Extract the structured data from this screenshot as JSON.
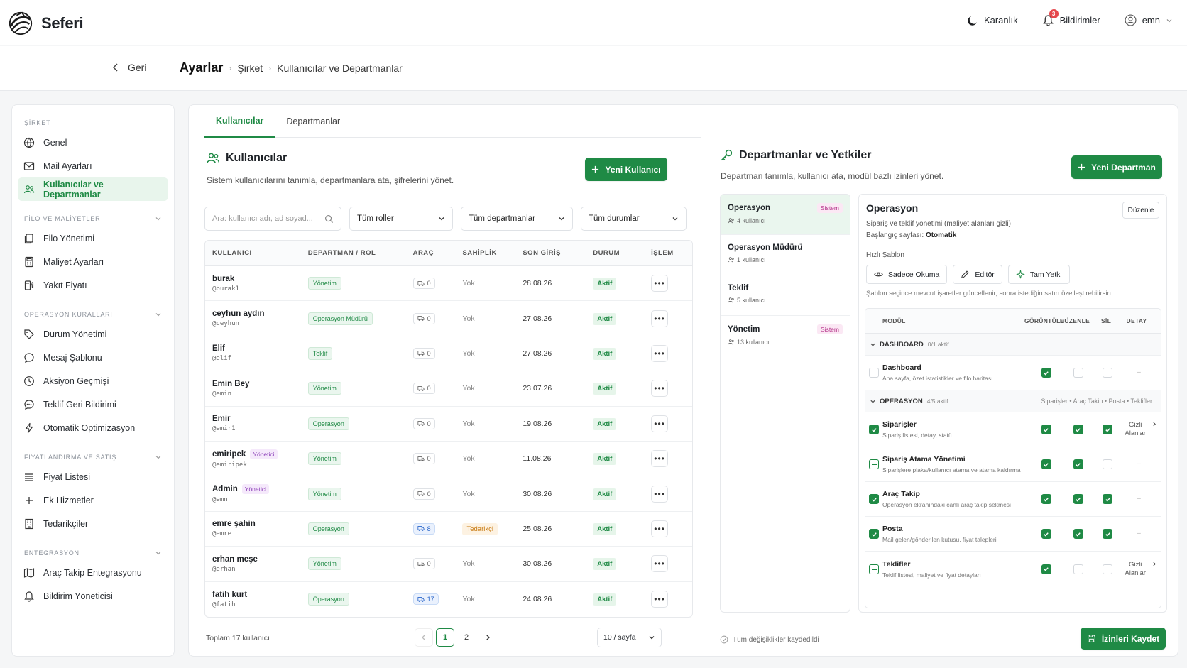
{
  "app": {
    "name": "Seferi"
  },
  "top": {
    "theme": "Karanlık",
    "notifications": "Bildirimler",
    "notif_count": "3",
    "user": "emn"
  },
  "crumbs": {
    "back": "Geri",
    "title": "Ayarlar",
    "level1": "Şirket",
    "level2": "Kullanıcılar ve Departmanlar"
  },
  "sidebar": {
    "sections": [
      {
        "title": "ŞİRKET",
        "items": [
          "Genel",
          "Mail Ayarları",
          "Kullanıcılar ve Departmanlar"
        ]
      },
      {
        "title": "FİLO VE MALİYETLER",
        "items": [
          "Filo Yönetimi",
          "Maliyet Ayarları",
          "Yakıt Fiyatı"
        ]
      },
      {
        "title": "OPERASYON KURALLARI",
        "items": [
          "Durum Yönetimi",
          "Mesaj Şablonu",
          "Aksiyon Geçmişi",
          "Teklif Geri Bildirimi",
          "Otomatik Optimizasyon"
        ]
      },
      {
        "title": "FİYATLANDIRMA VE SATIŞ",
        "items": [
          "Fiyat Listesi",
          "Ek Hizmetler",
          "Tedarikçiler"
        ]
      },
      {
        "title": "ENTEGRASYON",
        "items": [
          "Araç Takip Entegrasyonu",
          "Bildirim Yöneticisi"
        ]
      }
    ]
  },
  "tabs": [
    "Kullanıcılar",
    "Departmanlar"
  ],
  "users": {
    "title": "Kullanıcılar",
    "subtitle": "Sistem kullanıcılarını tanımla, departmanlara ata, şifrelerini yönet.",
    "new_button": "Yeni Kullanıcı",
    "search_placeholder": "Ara: kullanıcı adı, ad soyad...",
    "filter_roles": "Tüm roller",
    "filter_depts": "Tüm departmanlar",
    "filter_status": "Tüm durumlar",
    "columns": [
      "KULLANICI",
      "DEPARTMAN / ROL",
      "ARAÇ",
      "SAHİPLİK",
      "SON GİRİŞ",
      "DURUM",
      "İŞLEM"
    ],
    "rows": [
      {
        "name": "burak",
        "handle": "@burak1",
        "admin": "",
        "role": "Yönetim",
        "vehicles": "0",
        "vehicles_on": false,
        "own": "Yok",
        "own_tag": false,
        "last": "28.08.26",
        "status": "Aktif"
      },
      {
        "name": "ceyhun aydın",
        "handle": "@ceyhun",
        "admin": "",
        "role": "Operasyon Müdürü",
        "vehicles": "0",
        "vehicles_on": false,
        "own": "Yok",
        "own_tag": false,
        "last": "27.08.26",
        "status": "Aktif"
      },
      {
        "name": "Elif",
        "handle": "@elif",
        "admin": "",
        "role": "Teklif",
        "vehicles": "0",
        "vehicles_on": false,
        "own": "Yok",
        "own_tag": false,
        "last": "27.08.26",
        "status": "Aktif"
      },
      {
        "name": "Emin Bey",
        "handle": "@emin",
        "admin": "",
        "role": "Yönetim",
        "vehicles": "0",
        "vehicles_on": false,
        "own": "Yok",
        "own_tag": false,
        "last": "23.07.26",
        "status": "Aktif"
      },
      {
        "name": "Emir",
        "handle": "@emir1",
        "admin": "",
        "role": "Operasyon",
        "vehicles": "0",
        "vehicles_on": false,
        "own": "Yok",
        "own_tag": false,
        "last": "19.08.26",
        "status": "Aktif"
      },
      {
        "name": "emiripek",
        "handle": "@emiripek",
        "admin": "Yönetici",
        "role": "Yönetim",
        "vehicles": "0",
        "vehicles_on": false,
        "own": "Yok",
        "own_tag": false,
        "last": "11.08.26",
        "status": "Aktif"
      },
      {
        "name": "Admin",
        "handle": "@emn",
        "admin": "Yönetici",
        "role": "Yönetim",
        "vehicles": "0",
        "vehicles_on": false,
        "own": "Yok",
        "own_tag": false,
        "last": "30.08.26",
        "status": "Aktif"
      },
      {
        "name": "emre şahin",
        "handle": "@emre",
        "admin": "",
        "role": "Operasyon",
        "vehicles": "8",
        "vehicles_on": true,
        "own": "Tedarikçi",
        "own_tag": true,
        "last": "25.08.26",
        "status": "Aktif"
      },
      {
        "name": "erhan meşe",
        "handle": "@erhan",
        "admin": "",
        "role": "Yönetim",
        "vehicles": "0",
        "vehicles_on": false,
        "own": "Yok",
        "own_tag": false,
        "last": "30.08.26",
        "status": "Aktif"
      },
      {
        "name": "fatih kurt",
        "handle": "@fatih",
        "admin": "",
        "role": "Operasyon",
        "vehicles": "17",
        "vehicles_on": true,
        "own": "Yok",
        "own_tag": false,
        "last": "24.08.26",
        "status": "Aktif"
      }
    ],
    "total": "Toplam 17 kullanıcı",
    "pages": [
      "1",
      "2"
    ],
    "per_page": "10 / sayfa"
  },
  "depts": {
    "title": "Departmanlar ve Yetkiler",
    "subtitle": "Departman tanımla, kullanıcı ata, modül bazlı izinleri yönet.",
    "new_button": "Yeni Departman",
    "list": [
      {
        "name": "Operasyon",
        "count": "4 kullanıcı",
        "sys": "Sistem"
      },
      {
        "name": "Operasyon Müdürü",
        "count": "1 kullanıcı",
        "sys": ""
      },
      {
        "name": "Teklif",
        "count": "5 kullanıcı",
        "sys": ""
      },
      {
        "name": "Yönetim",
        "count": "13 kullanıcı",
        "sys": "Sistem"
      }
    ],
    "selected": {
      "name": "Operasyon",
      "edit": "Düzenle",
      "desc": "Sipariş ve teklif yönetimi (maliyet alanları gizli)",
      "start_label": "Başlangıç sayfası:",
      "start_value": "Otomatik",
      "quick_label": "Hızlı Şablon",
      "presets": [
        "Sadece Okuma",
        "Editör",
        "Tam Yetki"
      ],
      "note": "Şablon seçince mevcut işaretler güncellenir, sonra istediğin satırı özelleştirebilirsin."
    },
    "perm_columns": [
      "MODÜL",
      "GÖRÜNTÜLE",
      "DÜZENLE",
      "SİL",
      "DETAY"
    ],
    "groups": [
      {
        "name": "DASHBOARD",
        "count": "0/1 aktif",
        "sub": "",
        "rows": [
          {
            "name": "Dashboard",
            "desc": "Ana sayfa, özet istatistikler ve filo haritası",
            "row": "off",
            "view": true,
            "edit": false,
            "del": false,
            "detail": "–"
          }
        ]
      },
      {
        "name": "OPERASYON",
        "count": "4/5 aktif",
        "sub": "Siparişler • Araç Takip • Posta • Teklifler",
        "rows": [
          {
            "name": "Siparişler",
            "desc": "Sipariş listesi, detay, statü",
            "row": "on",
            "view": true,
            "edit": true,
            "del": true,
            "detail": "Gizli Alanlar"
          },
          {
            "name": "Sipariş Atama Yönetimi",
            "desc": "Siparişlere plaka/kullanıcı atama ve atama kaldırma",
            "row": "part",
            "view": true,
            "edit": true,
            "del": false,
            "detail": "–"
          },
          {
            "name": "Araç Takip",
            "desc": "Operasyon ekranındaki canlı araç takip sekmesi",
            "row": "on",
            "view": true,
            "edit": true,
            "del": true,
            "detail": "–"
          },
          {
            "name": "Posta",
            "desc": "Mail gelen/gönderilen kutusu, fiyat talepleri",
            "row": "on",
            "view": true,
            "edit": true,
            "del": true,
            "detail": "–"
          },
          {
            "name": "Teklifler",
            "desc": "Teklif listesi, maliyet ve fiyat detayları",
            "row": "part",
            "view": true,
            "edit": false,
            "del": false,
            "detail": "Gizli Alanlar"
          }
        ]
      }
    ],
    "saved": "Tüm değişiklikler kaydedildi",
    "save_button": "İzinleri Kaydet"
  },
  "colors": {
    "accent": "#1f8a45",
    "accent_soft": "#eaf6ee",
    "danger": "#e5484d",
    "admin_tag": "#8b3fb8",
    "system_tag": "#b5338a",
    "supplier_tag": "#c8790f",
    "vehicle_on": "#2563c9"
  }
}
